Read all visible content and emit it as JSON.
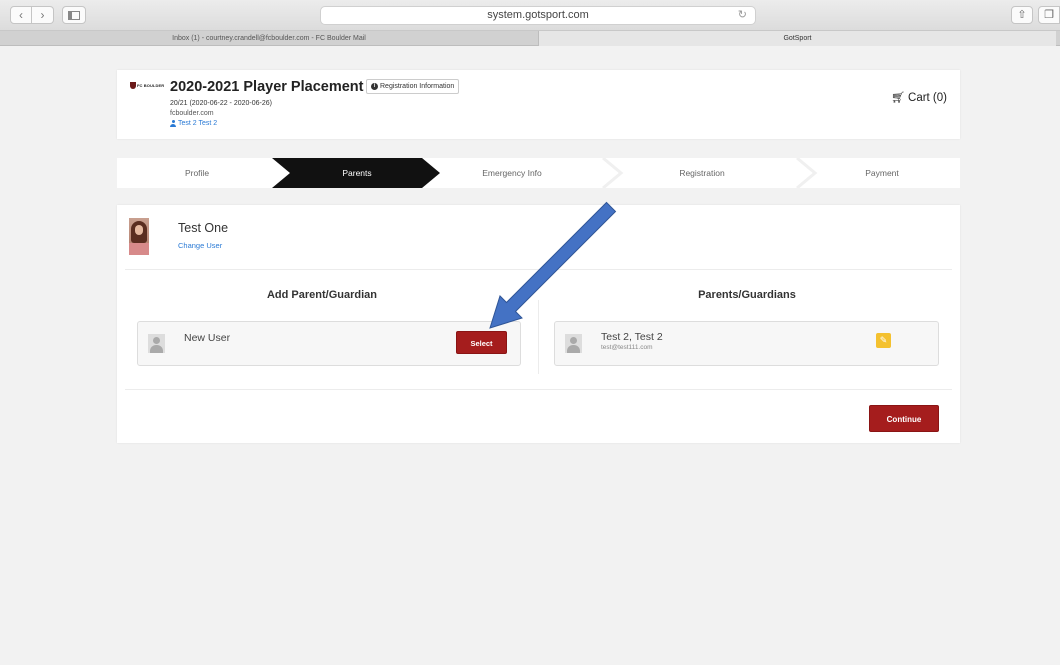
{
  "browser": {
    "address": "system.gotsport.com",
    "tabs": [
      {
        "label": "Inbox (1) - courtney.crandell@fcboulder.com - FC Boulder Mail"
      },
      {
        "label": "GotSport"
      }
    ]
  },
  "header": {
    "logo_text": "FC BOULDER",
    "event_title": "2020-2021 Player Placement",
    "reg_info_label": "Registration Information",
    "dates": "20/21 (2020-06-22 - 2020-06-26)",
    "site": "fcboulder.com",
    "user": "Test 2 Test 2",
    "cart_label": "Cart (0)"
  },
  "steps": [
    {
      "label": "Profile",
      "active": false
    },
    {
      "label": "Parents",
      "active": true
    },
    {
      "label": "Emergency Info",
      "active": false
    },
    {
      "label": "Registration",
      "active": false
    },
    {
      "label": "Payment",
      "active": false
    }
  ],
  "player": {
    "name": "Test One",
    "change_user_label": "Change User"
  },
  "add_parent": {
    "heading": "Add Parent/Guardian",
    "new_user_label": "New User",
    "select_label": "Select"
  },
  "parents": {
    "heading": "Parents/Guardians",
    "items": [
      {
        "name": "Test 2, Test 2",
        "email": "test@test111.com"
      }
    ]
  },
  "continue_label": "Continue",
  "colors": {
    "brand_red": "#a51d1d",
    "link_blue": "#2a7ad5",
    "edit_yellow": "#f4c12f",
    "annotation_arrow": "#4472c4"
  },
  "icons": [
    "info-icon",
    "user-icon",
    "cart-icon",
    "person-icon",
    "pencil-icon",
    "annotation-arrow"
  ]
}
